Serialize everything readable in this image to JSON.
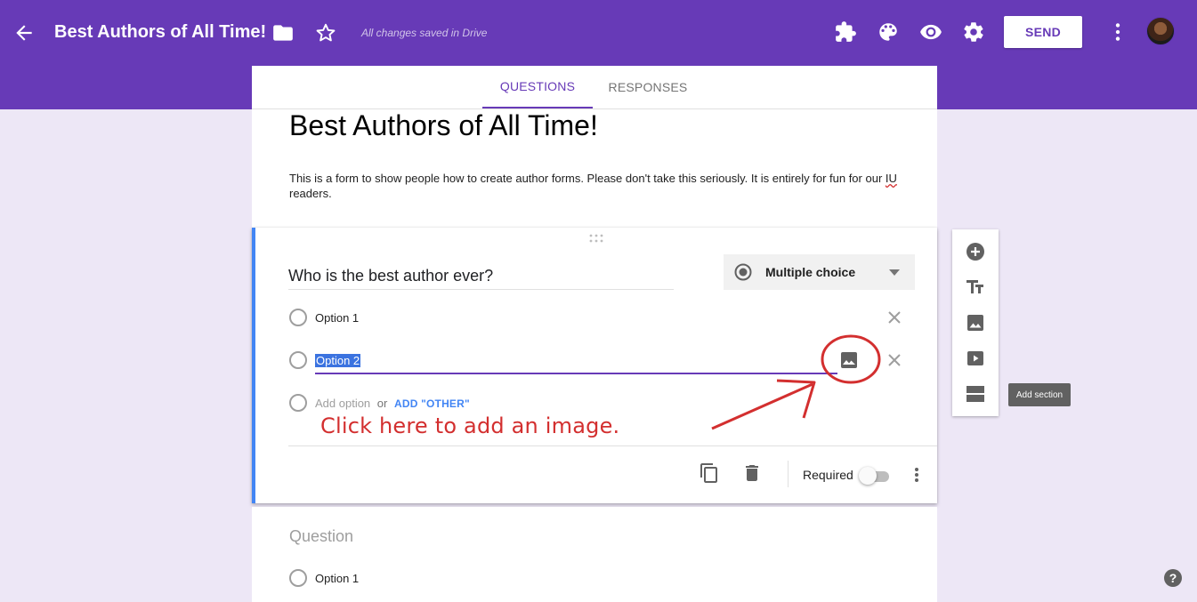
{
  "header": {
    "title": "Best Authors of All Time!",
    "save_status": "All changes saved in Drive",
    "send_label": "SEND",
    "icons": [
      "back-arrow-icon",
      "folder-icon",
      "star-icon",
      "addon-icon",
      "palette-icon",
      "preview-eye-icon",
      "settings-gear-icon",
      "more-vert-icon"
    ]
  },
  "tabs": [
    {
      "label": "QUESTIONS",
      "active": true
    },
    {
      "label": "RESPONSES",
      "active": false
    }
  ],
  "form": {
    "title": "Best Authors of All Time!",
    "description_main": "This is a form to show people how to create author forms. Please don't take this seriously. It is entirely for fun for our ",
    "description_flagged": "IU",
    "description_tail": "readers."
  },
  "question1": {
    "title": "Who is the best author ever?",
    "type_label": "Multiple choice",
    "options": [
      "Option 1",
      "Option 2"
    ],
    "add_option": "Add option",
    "or_text": "or",
    "add_other": "ADD \"OTHER\"",
    "required_label": "Required",
    "required": false
  },
  "annotation": {
    "text": "Click here to add an image."
  },
  "side_toolbar": {
    "tooltip": "Add section",
    "icons": [
      "add-question-icon",
      "add-title-icon",
      "add-image-icon",
      "add-video-icon",
      "add-section-icon"
    ]
  },
  "question2": {
    "title_placeholder": "Question",
    "option": "Option 1"
  },
  "colors": {
    "primary": "#673ab7",
    "background": "#ede7f6",
    "accent_blue": "#4285f4",
    "annotation_red": "#d32f2f"
  }
}
